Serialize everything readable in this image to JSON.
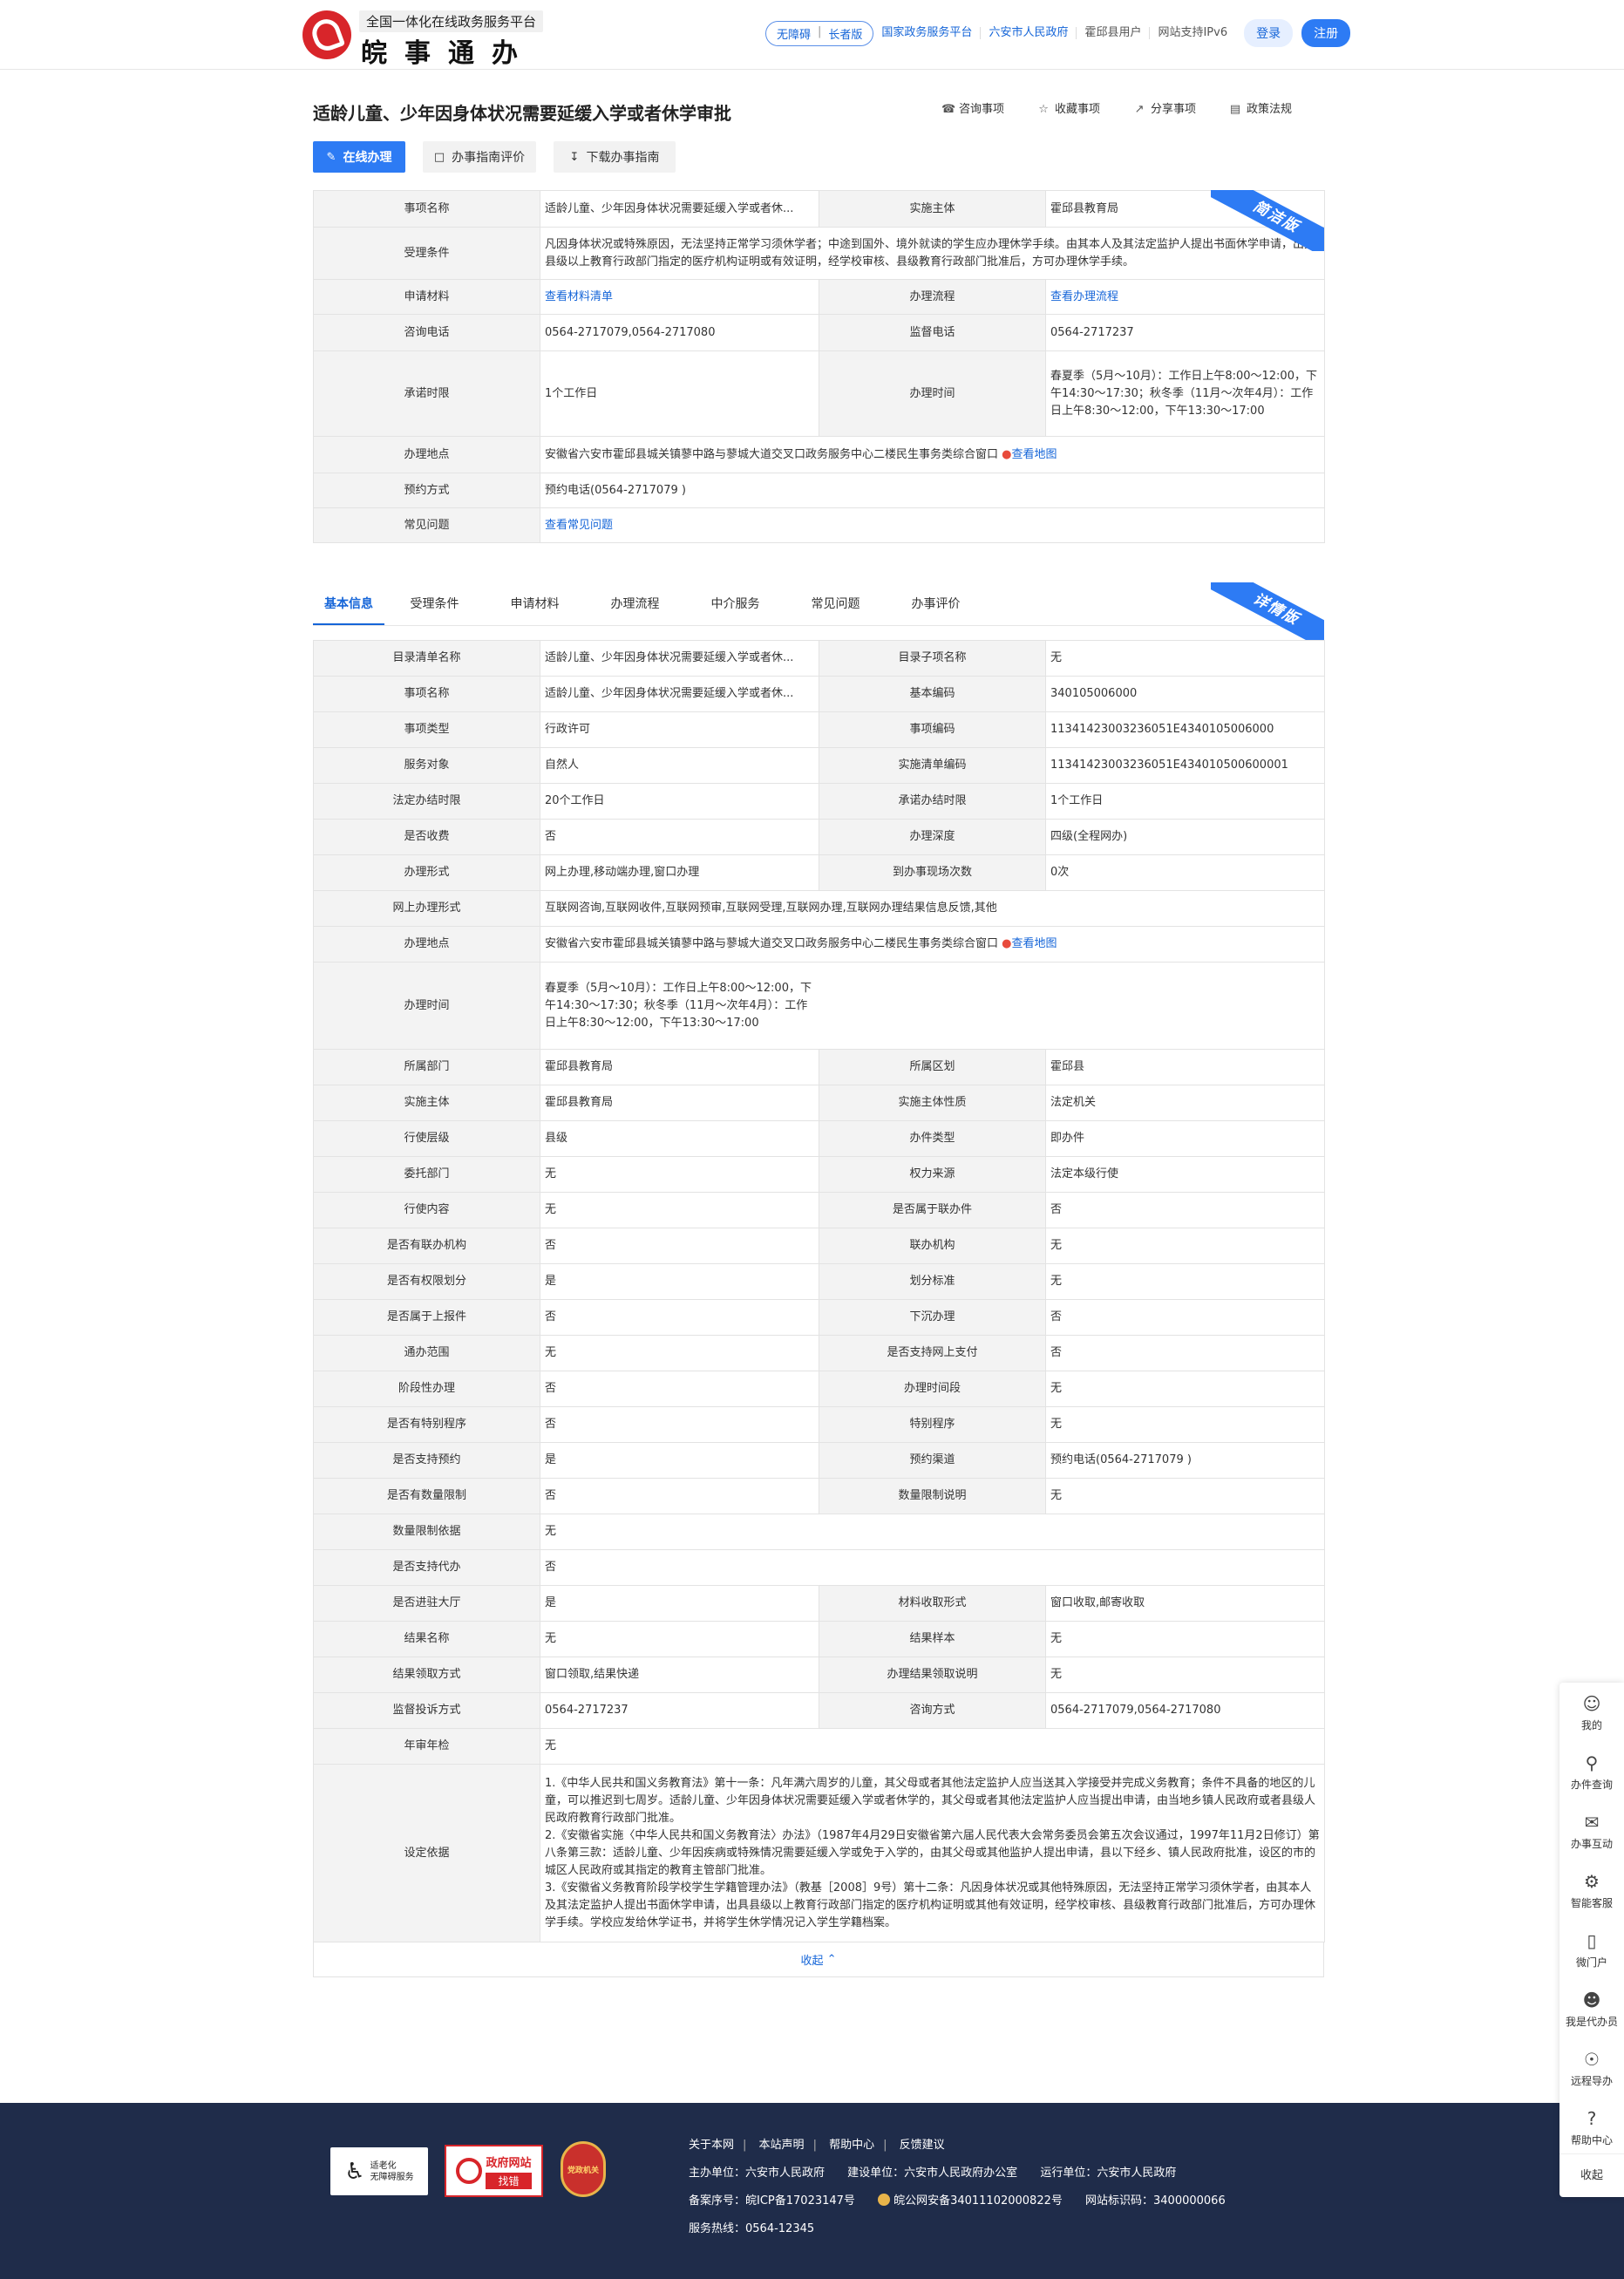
{
  "header": {
    "logo_subtitle": "全国一体化在线政务服务平台",
    "logo_title": "皖事通办",
    "accessibility": "无障碍",
    "elder": "长者版",
    "links": [
      "国家政务服务平台",
      "六安市人民政府",
      "霍邱县用户",
      "网站支持IPv6"
    ],
    "login": "登录",
    "register": "注册"
  },
  "title": "适龄儿童、少年因身体状况需要延缓入学或者休学审批",
  "actions": [
    {
      "icon": "headset-icon",
      "label": "咨询事项"
    },
    {
      "icon": "star-icon",
      "label": "收藏事项"
    },
    {
      "icon": "share-icon",
      "label": "分享事项"
    },
    {
      "icon": "document-icon",
      "label": "政策法规"
    }
  ],
  "buttons": {
    "online": "在线办理",
    "evaluate": "办事指南评价",
    "download": "下载办事指南"
  },
  "simple": {
    "ribbon": "简洁版",
    "item_name_key": "事项名称",
    "item_name": "适龄儿童、少年因身体状况需要延缓入学或者休...",
    "subject_key": "实施主体",
    "subject": "霍邱县教育局",
    "condition_key": "受理条件",
    "condition": "凡因身体状况或特殊原因，无法坚持正常学习须休学者；中途到国外、境外就读的学生应办理休学手续。由其本人及其法定监护人提出书面休学申请，出具县级以上教育行政部门指定的医疗机构证明或有效证明，经学校审核、县级教育行政部门批准后，方可办理休学手续。",
    "materials_key": "申请材料",
    "materials": "查看材料清单",
    "process_key": "办理流程",
    "process": "查看办理流程",
    "phone_key": "咨询电话",
    "phone": "0564-2717079,0564-2717080",
    "supervise_key": "监督电话",
    "supervise": "0564-2717237",
    "promise_key": "承诺时限",
    "promise": "1个工作日",
    "hours_key": "办理时间",
    "hours": "春夏季（5月～10月）：工作日上午8:00～12:00，下午14:30～17:30；秋冬季（11月～次年4月）：工作日上午8:30～12:00，下午13:30～17:00",
    "place_key": "办理地点",
    "place": "安徽省六安市霍邱县城关镇蓼中路与蓼城大道交叉口政务服务中心二楼民生事务类综合窗口",
    "map": "查看地图",
    "reserve_key": "预约方式",
    "reserve": "预约电话(0564-2717079 )",
    "faq_key": "常见问题",
    "faq": "查看常见问题"
  },
  "tabs": [
    "基本信息",
    "受理条件",
    "申请材料",
    "办理流程",
    "中介服务",
    "常见问题",
    "办事评价"
  ],
  "detail": {
    "ribbon": "详情版",
    "hours": "春夏季（5月～10月）：工作日上午8:00～12:00，下午14:30～17:30；秋冬季（11月～次年4月）：工作日上午8:30～12:00，下午13:30～17:00",
    "place": "安徽省六安市霍邱县城关镇蓼中路与蓼城大道交叉口政务服务中心二楼民生事务类综合窗口",
    "map": "查看地图",
    "basis_key": "设定依据",
    "basis": [
      "1.《中华人民共和国义务教育法》第十一条：凡年满六周岁的儿童，其父母或者其他法定监护人应当送其入学接受并完成义务教育；条件不具备的地区的儿童，可以推迟到七周岁。适龄儿童、少年因身体状况需要延缓入学或者休学的，其父母或者其他法定监护人应当提出申请，由当地乡镇人民政府或者县级人民政府教育行政部门批准。",
      "2.《安徽省实施〈中华人民共和国义务教育法〉办法》（1987年4月29日安徽省第六届人民代表大会常务委员会第五次会议通过，1997年11月2日修订）第八条第三款：适龄儿童、少年因疾病或特殊情况需要延缓入学或免于入学的，由其父母或其他监护人提出申请，县以下经乡、镇人民政府批准，设区的市的城区人民政府或其指定的教育主管部门批准。",
      "3.《安徽省义务教育阶段学校学生学籍管理办法》（教基［2008］9号）第十二条：凡因身体状况或其他特殊原因，无法坚持正常学习须休学者，由其本人及其法定监护人提出书面休学申请，出具县级以上教育行政部门指定的医疗机构证明或其他有效证明，经学校审核、县级教育行政部门批准后，方可办理休学手续。学校应发给休学证书，并将学生休学情况记入学生学籍档案。"
    ],
    "rows": [
      [
        "目录清单名称",
        "适龄儿童、少年因身体状况需要延缓入学或者休...",
        "目录子项名称",
        "无"
      ],
      [
        "事项名称",
        "适龄儿童、少年因身体状况需要延缓入学或者休...",
        "基本编码",
        "340105006000"
      ],
      [
        "事项类型",
        "行政许可",
        "事项编码",
        "11341423003236051E4340105006000"
      ],
      [
        "服务对象",
        "自然人",
        "实施清单编码",
        "11341423003236051E434010500600001"
      ],
      [
        "法定办结时限",
        "20个工作日",
        "承诺办结时限",
        "1个工作日"
      ],
      [
        "是否收费",
        "否",
        "办理深度",
        "四级(全程网办)"
      ],
      [
        "办理形式",
        "网上办理,移动端办理,窗口办理",
        "到办事现场次数",
        "0次"
      ],
      [
        "网上办理形式",
        "互联网咨询,互联网收件,互联网预审,互联网受理,互联网办理,互联网办理结果信息反馈,其他"
      ],
      [
        "办理地点",
        "__place__"
      ],
      [
        "办理时间",
        "__hours__"
      ],
      [
        "所属部门",
        "霍邱县教育局",
        "所属区划",
        "霍邱县"
      ],
      [
        "实施主体",
        "霍邱县教育局",
        "实施主体性质",
        "法定机关"
      ],
      [
        "行使层级",
        "县级",
        "办件类型",
        "即办件"
      ],
      [
        "委托部门",
        "无",
        "权力来源",
        "法定本级行使"
      ],
      [
        "行使内容",
        "无",
        "是否属于联办件",
        "否"
      ],
      [
        "是否有联办机构",
        "否",
        "联办机构",
        "无"
      ],
      [
        "是否有权限划分",
        "是",
        "划分标准",
        "无"
      ],
      [
        "是否属于上报件",
        "否",
        "下沉办理",
        "否"
      ],
      [
        "通办范围",
        "无",
        "是否支持网上支付",
        "否"
      ],
      [
        "阶段性办理",
        "否",
        "办理时间段",
        "无"
      ],
      [
        "是否有特别程序",
        "否",
        "特别程序",
        "无"
      ],
      [
        "是否支持预约",
        "是",
        "预约渠道",
        "预约电话(0564-2717079 )"
      ],
      [
        "是否有数量限制",
        "否",
        "数量限制说明",
        "无"
      ],
      [
        "数量限制依据",
        "无"
      ],
      [
        "是否支持代办",
        "否"
      ],
      [
        "是否进驻大厅",
        "是",
        "材料收取形式",
        "窗口收取,邮寄收取"
      ],
      [
        "结果名称",
        "无",
        "结果样本",
        "无"
      ],
      [
        "结果领取方式",
        "窗口领取,结果快递",
        "办理结果领取说明",
        "无"
      ],
      [
        "监督投诉方式",
        "0564-2717237",
        "咨询方式",
        "0564-2717079,0564-2717080"
      ],
      [
        "年审年检",
        "无"
      ]
    ],
    "collapse": "收起"
  },
  "footer": {
    "links": [
      "关于本网",
      "本站声明",
      "帮助中心",
      "反馈建议"
    ],
    "host": "主办单位：六安市人民政府",
    "builder": "建设单位：六安市人民政府办公室",
    "operator": "运行单位：六安市人民政府",
    "icp": "备案序号：皖ICP备17023147号",
    "police": "皖公网安备34011102000822号",
    "site_code": "网站标识码：3400000066",
    "hotline": "服务热线：0564-12345",
    "badge_elder_1": "适老化",
    "badge_elder_2": "无障碍服务",
    "badge_gov_1": "政府网站",
    "badge_gov_2": "找错",
    "badge_party": "党政机关"
  },
  "sidebar": [
    {
      "icon": "user-icon",
      "label": "我的"
    },
    {
      "icon": "search-icon",
      "label": "办件查询"
    },
    {
      "icon": "chat-icon",
      "label": "办事互动"
    },
    {
      "icon": "robot-icon",
      "label": "智能客服"
    },
    {
      "icon": "phone-icon",
      "label": "微门户"
    },
    {
      "icon": "agent-icon",
      "label": "我是代办员"
    },
    {
      "icon": "remote-icon",
      "label": "远程导办"
    },
    {
      "icon": "help-icon",
      "label": "帮助中心"
    }
  ],
  "sidebar_close": "收起"
}
